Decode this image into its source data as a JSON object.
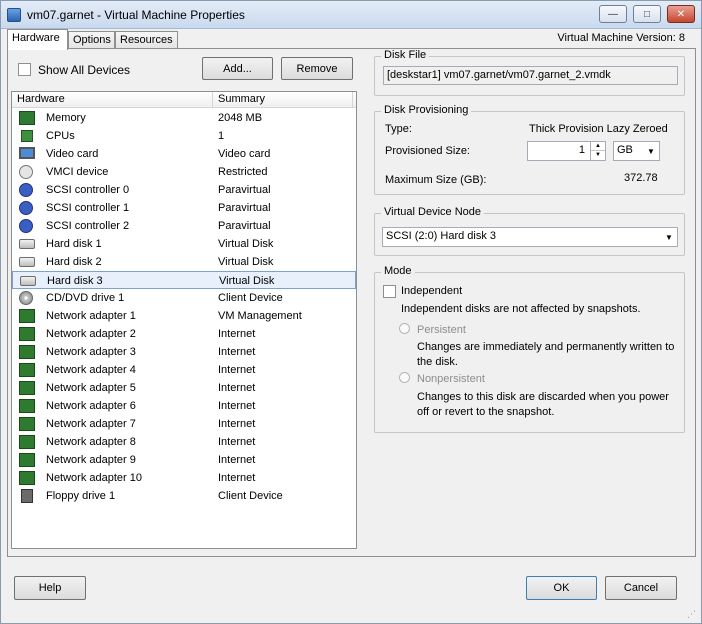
{
  "window": {
    "title": "vm07.garnet - Virtual Machine Properties",
    "version": "Virtual Machine Version: 8",
    "controls": {
      "minimize": "—",
      "maximize": "□",
      "close": "✕"
    }
  },
  "tabs": [
    {
      "label": "Hardware"
    },
    {
      "label": "Options"
    },
    {
      "label": "Resources"
    }
  ],
  "hardware_panel": {
    "show_all_devices": "Show All Devices",
    "add_label": "Add...",
    "remove_label": "Remove",
    "columns": {
      "hardware": "Hardware",
      "summary": "Summary"
    },
    "rows": [
      {
        "name": "Memory",
        "summary": "2048 MB",
        "icon": "memory-icon"
      },
      {
        "name": "CPUs",
        "summary": "1",
        "icon": "cpu-icon"
      },
      {
        "name": "Video card",
        "summary": "Video card",
        "icon": "monitor-icon"
      },
      {
        "name": "VMCI device",
        "summary": "Restricted",
        "icon": "vmci-icon"
      },
      {
        "name": "SCSI controller 0",
        "summary": "Paravirtual",
        "icon": "scsi-icon"
      },
      {
        "name": "SCSI controller 1",
        "summary": "Paravirtual",
        "icon": "scsi-icon"
      },
      {
        "name": "SCSI controller 2",
        "summary": "Paravirtual",
        "icon": "scsi-icon"
      },
      {
        "name": "Hard disk 1",
        "summary": "Virtual Disk",
        "icon": "hard-disk-icon"
      },
      {
        "name": "Hard disk 2",
        "summary": "Virtual Disk",
        "icon": "hard-disk-icon"
      },
      {
        "name": "Hard disk 3",
        "summary": "Virtual Disk",
        "icon": "hard-disk-icon"
      },
      {
        "name": "CD/DVD drive 1",
        "summary": "Client Device",
        "icon": "cd-dvd-icon"
      },
      {
        "name": "Network adapter 1",
        "summary": "VM Management",
        "icon": "network-adapter-icon"
      },
      {
        "name": "Network adapter 2",
        "summary": "Internet",
        "icon": "network-adapter-icon"
      },
      {
        "name": "Network adapter 3",
        "summary": "Internet",
        "icon": "network-adapter-icon"
      },
      {
        "name": "Network adapter 4",
        "summary": "Internet",
        "icon": "network-adapter-icon"
      },
      {
        "name": "Network adapter 5",
        "summary": "Internet",
        "icon": "network-adapter-icon"
      },
      {
        "name": "Network adapter 6",
        "summary": "Internet",
        "icon": "network-adapter-icon"
      },
      {
        "name": "Network adapter 7",
        "summary": "Internet",
        "icon": "network-adapter-icon"
      },
      {
        "name": "Network adapter 8",
        "summary": "Internet",
        "icon": "network-adapter-icon"
      },
      {
        "name": "Network adapter 9",
        "summary": "Internet",
        "icon": "network-adapter-icon"
      },
      {
        "name": "Network adapter 10",
        "summary": "Internet",
        "icon": "network-adapter-icon"
      },
      {
        "name": "Floppy drive 1",
        "summary": "Client Device",
        "icon": "floppy-icon"
      }
    ],
    "selected": "Hard disk 3"
  },
  "disk_file": {
    "title": "Disk File",
    "value": "[deskstar1] vm07.garnet/vm07.garnet_2.vmdk"
  },
  "disk_provisioning": {
    "title": "Disk Provisioning",
    "type_label": "Type:",
    "type_value": "Thick Provision Lazy Zeroed",
    "provisioned_label": "Provisioned Size:",
    "provisioned_value": "1",
    "unit_value": "GB",
    "max_label": "Maximum Size (GB):",
    "max_value": "372.78"
  },
  "virtual_device_node": {
    "title": "Virtual Device Node",
    "value": "SCSI (2:0) Hard disk 3"
  },
  "mode": {
    "title": "Mode",
    "independent_label": "Independent",
    "independent_desc": "Independent disks are not affected by snapshots.",
    "persistent_label": "Persistent",
    "persistent_desc": "Changes are immediately and permanently written to the disk.",
    "nonpersistent_label": "Nonpersistent",
    "nonpersistent_desc": "Changes to this disk are discarded when you power off or revert to the snapshot."
  },
  "footer": {
    "help": "Help",
    "ok": "OK",
    "cancel": "Cancel"
  },
  "colors": {
    "selection_bg": "#e8f1fb",
    "selection_border": "#7da2ce",
    "titlebar": "#c9d9ee"
  }
}
